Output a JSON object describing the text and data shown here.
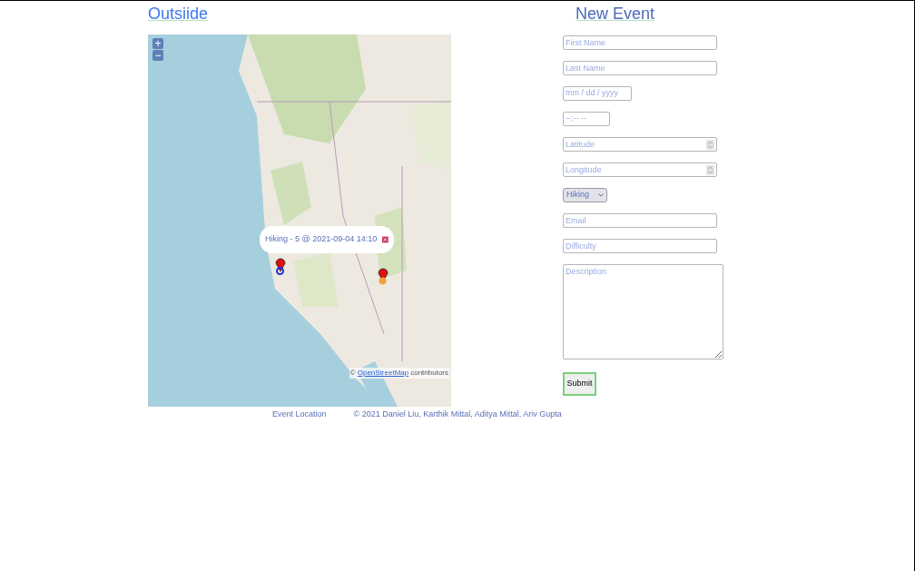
{
  "header": {
    "title": "Outsiide"
  },
  "map": {
    "zoom_in": "+",
    "zoom_out": "−",
    "popup": {
      "text": "Hiking - 5 @ 2021-09-04 14:10"
    },
    "attribution": {
      "prefix": "©",
      "link": "OpenStreetMap",
      "suffix": "contributors"
    },
    "caption": "Event Location"
  },
  "footer": {
    "copyright": "© 2021 Daniel Liu, Karthik Mittal, Aditya Mittal, Ariv Gupta"
  },
  "form": {
    "title": "New Event",
    "fields": [
      {
        "kind": "text",
        "placeholder": "First Name"
      },
      {
        "kind": "text",
        "placeholder": "Last Name"
      },
      {
        "kind": "date",
        "value": "mm / dd / yyyy"
      },
      {
        "kind": "time",
        "value": "--:-- --"
      },
      {
        "kind": "number",
        "placeholder": "Latitude"
      },
      {
        "kind": "number",
        "placeholder": "Longitude"
      },
      {
        "kind": "select",
        "value": "Hiking"
      },
      {
        "kind": "text",
        "placeholder": "Email"
      },
      {
        "kind": "text",
        "placeholder": "Difficulty"
      },
      {
        "kind": "textarea",
        "placeholder": "Description"
      }
    ],
    "submit": "Submit"
  }
}
